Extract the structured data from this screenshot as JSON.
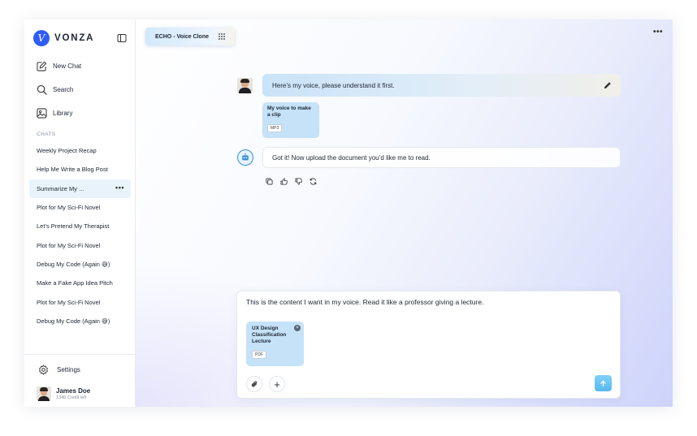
{
  "brand": {
    "name": "VONZA",
    "logo_letter": "V",
    "accent": "#2f5cf5"
  },
  "sidebar": {
    "nav": [
      {
        "label": "New Chat",
        "icon": "new-chat-icon"
      },
      {
        "label": "Search",
        "icon": "search-icon"
      },
      {
        "label": "Library",
        "icon": "library-icon"
      }
    ],
    "chats_label": "CHATS",
    "chats": [
      {
        "label": "Weekly Project Recap"
      },
      {
        "label": "Help Me Write a Blog Post"
      },
      {
        "label": "Summarize My ...",
        "active": true
      },
      {
        "label": "Plot for My Sci-Fi Novel"
      },
      {
        "label": "Let’s Pretend My Therapist"
      },
      {
        "label": "Plot for My Sci-Fi Novel"
      },
      {
        "label": "Debug My Code (Again 😅)"
      },
      {
        "label": "Make a Fake App Idea Pitch"
      },
      {
        "label": "Plot for My Sci-Fi Novel"
      },
      {
        "label": "Debug My Code (Again 😅)"
      }
    ],
    "more_label": "•••",
    "settings_label": "Settings",
    "user": {
      "name": "James Doe",
      "credit": "1346 Credit left"
    }
  },
  "main": {
    "model_tab": "ECHO - Voice Clone",
    "top_more": "•••",
    "user_message": "Here’s my voice, please understand it first.",
    "user_attachment": {
      "title": "My voice to make a clip",
      "type": "MP3"
    },
    "bot_message": "Got it! Now upload the document you’d like me to read.",
    "composer": {
      "text": "This is the content I want in my voice. Read it like a professor giving a lecture.",
      "attachment": {
        "title": "UX Design Classification Lecture",
        "type": "PDF"
      },
      "plus": "+"
    }
  }
}
